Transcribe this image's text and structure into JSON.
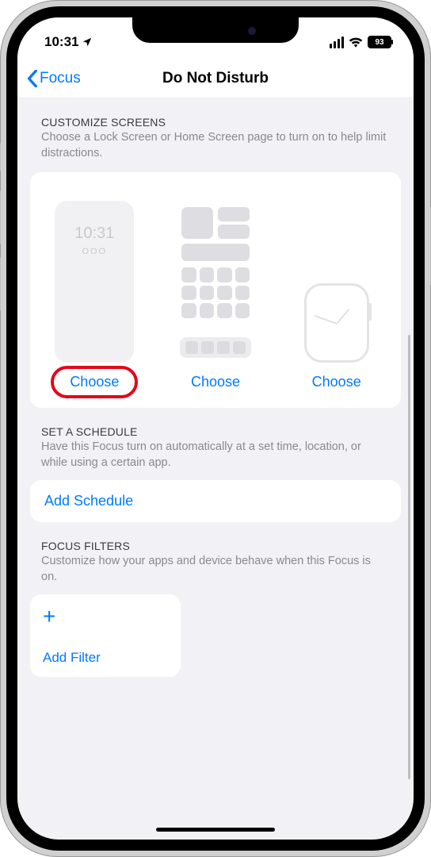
{
  "status": {
    "time": "10:31",
    "battery": "93"
  },
  "nav": {
    "back": "Focus",
    "title": "Do Not Disturb"
  },
  "customize": {
    "title": "CUSTOMIZE SCREENS",
    "desc": "Choose a Lock Screen or Home Screen page to turn on to help limit distractions.",
    "lock_time": "10:31",
    "lock_dots": "OOO",
    "choose1": "Choose",
    "choose2": "Choose",
    "choose3": "Choose"
  },
  "schedule": {
    "title": "SET A SCHEDULE",
    "desc": "Have this Focus turn on automatically at a set time, location, or while using a certain app.",
    "add": "Add Schedule"
  },
  "filters": {
    "title": "FOCUS FILTERS",
    "desc": "Customize how your apps and device behave when this Focus is on.",
    "add": "Add Filter"
  }
}
